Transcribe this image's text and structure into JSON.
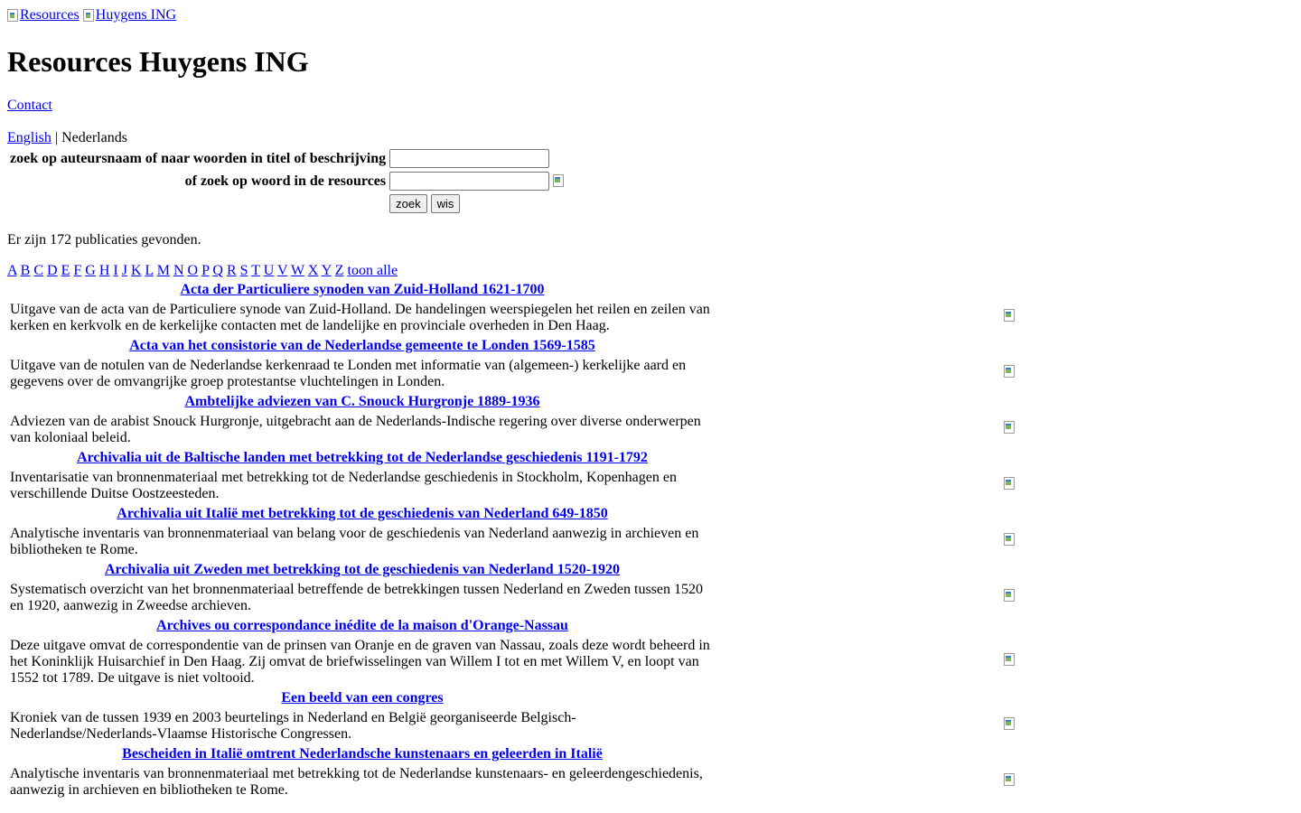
{
  "header": {
    "logo_resources_alt": "Resources",
    "logo_huygens_alt": "Huygens ING",
    "title": "Resources Huygens ING",
    "contact_label": "Contact"
  },
  "language": {
    "english_label": "English",
    "separator": "|",
    "current": "Nederlands"
  },
  "search": {
    "author_label": "zoek op auteursnaam of naar woorden in titel of beschrijving",
    "author_value": "",
    "word_label": "of zoek op woord in de resources",
    "word_value": "",
    "search_button": "zoek",
    "clear_button": "wis"
  },
  "result_count_text": "Er zijn 172 publicaties gevonden.",
  "alphabet": [
    "A",
    "B",
    "C",
    "D",
    "E",
    "F",
    "G",
    "H",
    "I",
    "J",
    "K",
    "L",
    "M",
    "N",
    "O",
    "P",
    "Q",
    "R",
    "S",
    "T",
    "U",
    "V",
    "W",
    "X",
    "Y",
    "Z"
  ],
  "show_all_label": "toon alle",
  "publications": [
    {
      "title": "Acta der Particuliere synoden van Zuid-Holland 1621-1700",
      "description": "Uitgave van de acta van de Particuliere synode van Zuid-Holland. De handelingen weerspiegelen het reilen en zeilen van kerken en kerkvolk en de kerkelijke contacten met de landelijke en provinciale overheden in Den Haag."
    },
    {
      "title": "Acta van het consistorie van de Nederlandse gemeente te Londen 1569-1585",
      "description": "Uitgave van de notulen van de Nederlandse kerkenraad te Londen met informatie van (algemeen-) kerkelijke aard en gegevens over de omvangrijke groep protestantse vluchtelingen in Londen."
    },
    {
      "title": "Ambtelijke adviezen van C. Snouck Hurgronje 1889-1936",
      "description": "Adviezen van de arabist Snouck Hurgronje, uitgebracht aan de Nederlands-Indische regering over diverse onderwerpen van koloniaal beleid."
    },
    {
      "title": "Archivalia uit de Baltische landen met betrekking tot de Nederlandse geschiedenis 1191-1792",
      "description": "Inventarisatie van bronnenmateriaal met betrekking tot de Nederlandse geschiedenis in Stockholm, Kopenhagen en verschillende Duitse Oostzeesteden."
    },
    {
      "title": "Archivalia uit Italië met betrekking tot de geschiedenis van Nederland 649-1850",
      "description": "Analytische inventaris van bronnenmateriaal van belang voor de geschiedenis van Nederland aanwezig in archieven en bibliotheken te Rome."
    },
    {
      "title": "Archivalia uit Zweden met betrekking tot de geschiedenis van Nederland 1520-1920",
      "description": "Systematisch overzicht van het bronnenmateriaal betreffende de betrekkingen tussen Nederland en Zweden tussen 1520 en 1920, aanwezig in Zweedse archieven."
    },
    {
      "title": "Archives ou correspondance inédite de la maison d'Orange-Nassau",
      "description": "Deze uitgave omvat de correspondentie van de prinsen van Oranje en de graven van Nassau, zoals deze wordt beheerd in het Koninklijk Huisarchief in Den Haag. Zij omvat de briefwisselingen van Willem I tot en met Willem V, en loopt van 1552 tot 1789. De uitgave is niet voltooid."
    },
    {
      "title": "Een beeld van een congres",
      "description": "Kroniek van de tussen 1939 en 2003 beurtelings in Nederland en België georganiseerde Belgisch-Nederlandse/Nederlands-Vlaamse Historische Congressen."
    },
    {
      "title": "Bescheiden in Italië omtrent Nederlandsche kunstenaars en geleerden in Italië",
      "description": "Analytische inventaris van bronnenmateriaal met betrekking tot de Nederlandse kunstenaars- en geleerdengeschiedenis, aanwezig in archieven en bibliotheken te Rome."
    }
  ]
}
